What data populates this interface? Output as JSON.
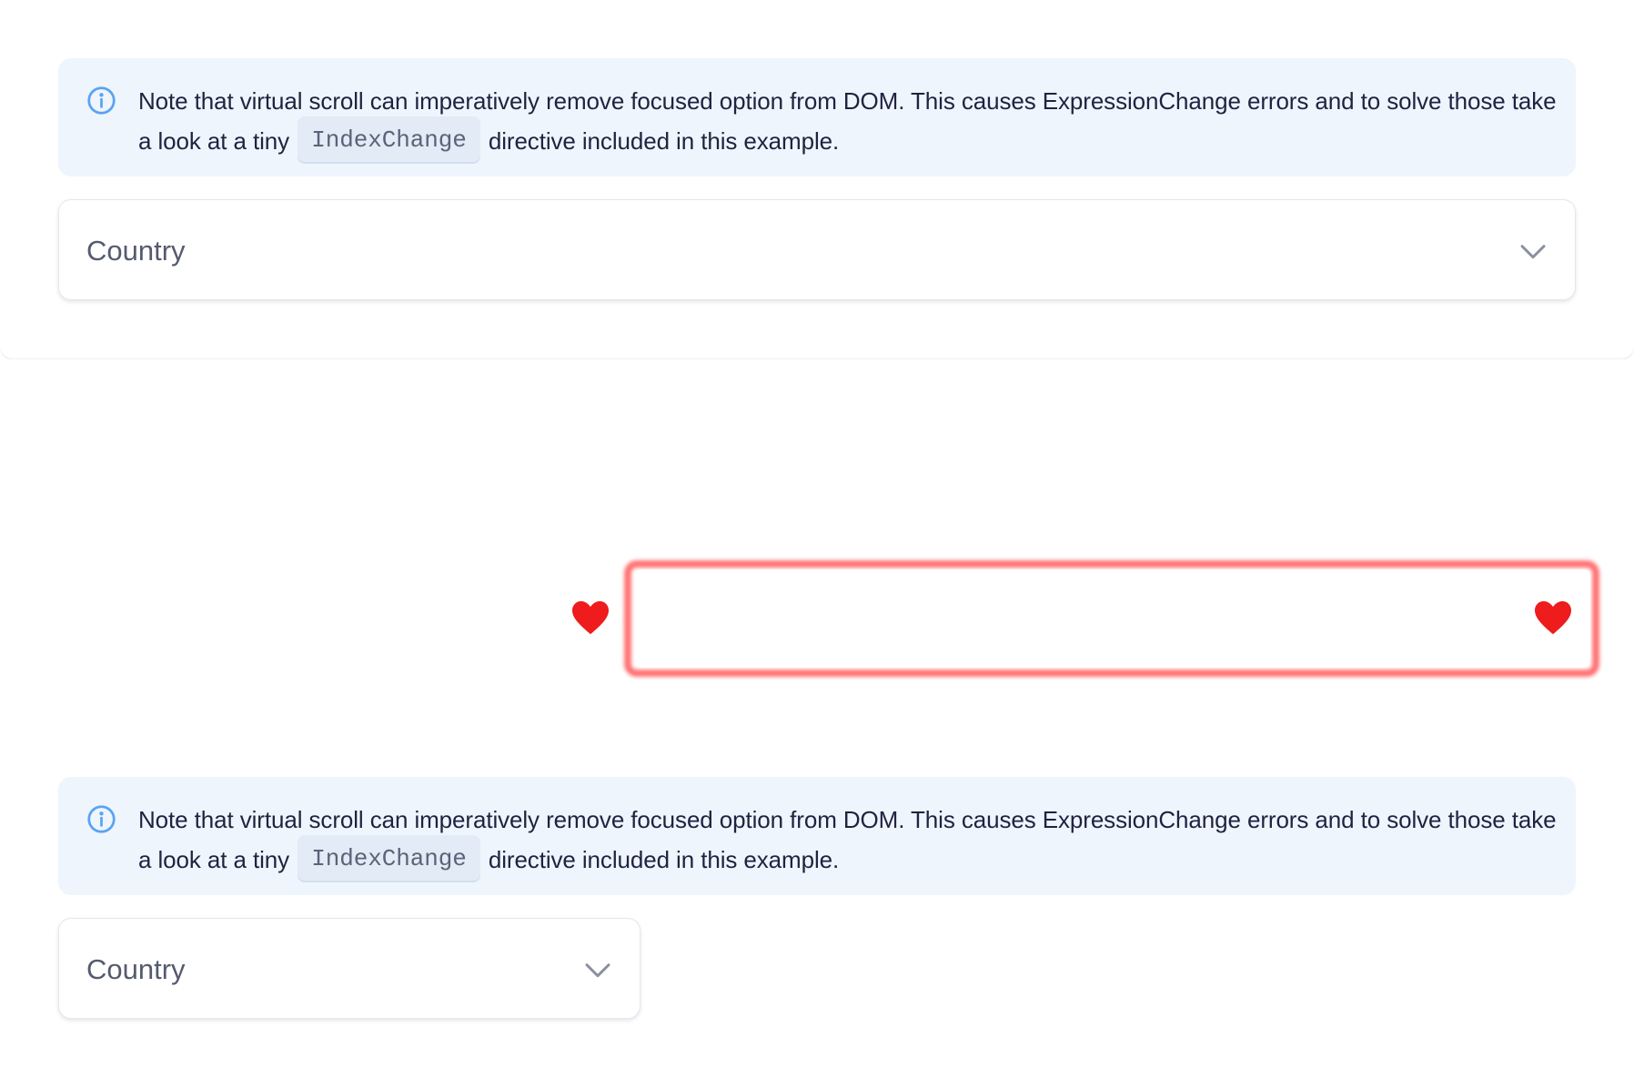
{
  "notice": {
    "icon": "info-circle-icon",
    "text_before": "Note that virtual scroll can imperatively remove focused option from DOM. This causes ExpressionChange errors and to solve those take a look at a tiny",
    "code": "IndexChange",
    "text_after": "directive included in this example.",
    "accent_color": "#5aa3f0",
    "background_color": "#eef5fd"
  },
  "select": {
    "label": "Country",
    "icon": "chevron-down-icon"
  },
  "decoration": {
    "left_icon": "heart-icon",
    "right_icon": "heart-icon",
    "frame_color": "#ff5a5a",
    "heart_color": "#ee1c1c"
  }
}
